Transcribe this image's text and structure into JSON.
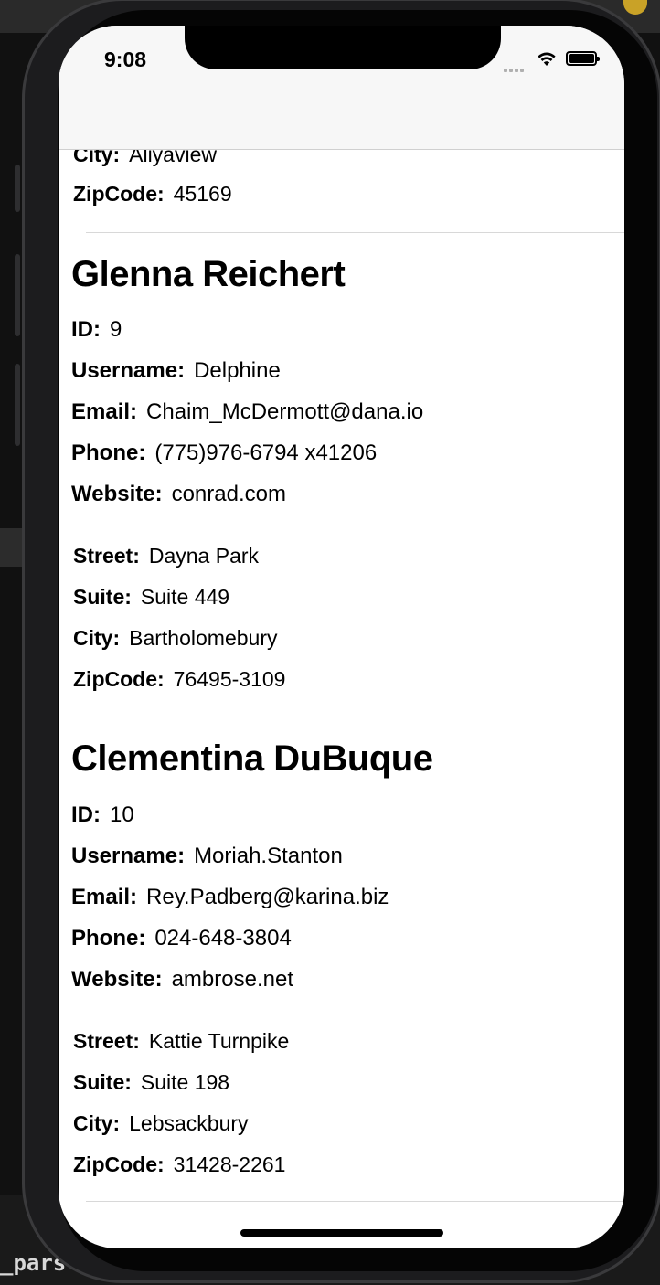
{
  "status": {
    "time": "9:08"
  },
  "partial_user": {
    "city_label": "City:",
    "city": "Aliyaview",
    "zip_label": "ZipCode:",
    "zip": "45169"
  },
  "users": [
    {
      "name": "Glenna Reichert",
      "id_label": "ID:",
      "id": "9",
      "username_label": "Username:",
      "username": "Delphine",
      "email_label": "Email:",
      "email": "Chaim_McDermott@dana.io",
      "phone_label": "Phone:",
      "phone": "(775)976-6794 x41206",
      "website_label": "Website:",
      "website": "conrad.com",
      "street_label": "Street:",
      "street": "Dayna Park",
      "suite_label": "Suite:",
      "suite": "Suite 449",
      "city_label": "City:",
      "city": "Bartholomebury",
      "zip_label": "ZipCode:",
      "zip": "76495-3109"
    },
    {
      "name": "Clementina DuBuque",
      "id_label": "ID:",
      "id": "10",
      "username_label": "Username:",
      "username": "Moriah.Stanton",
      "email_label": "Email:",
      "email": "Rey.Padberg@karina.biz",
      "phone_label": "Phone:",
      "phone": "024-648-3804",
      "website_label": "Website:",
      "website": "ambrose.net",
      "street_label": "Street:",
      "street": "Kattie Turnpike",
      "suite_label": "Suite:",
      "suite": "Suite 198",
      "city_label": "City:",
      "city": "Lebsackbury",
      "zip_label": "ZipCode:",
      "zip": "31428-2261"
    }
  ],
  "desktop": {
    "terminal_text": "_pars"
  }
}
